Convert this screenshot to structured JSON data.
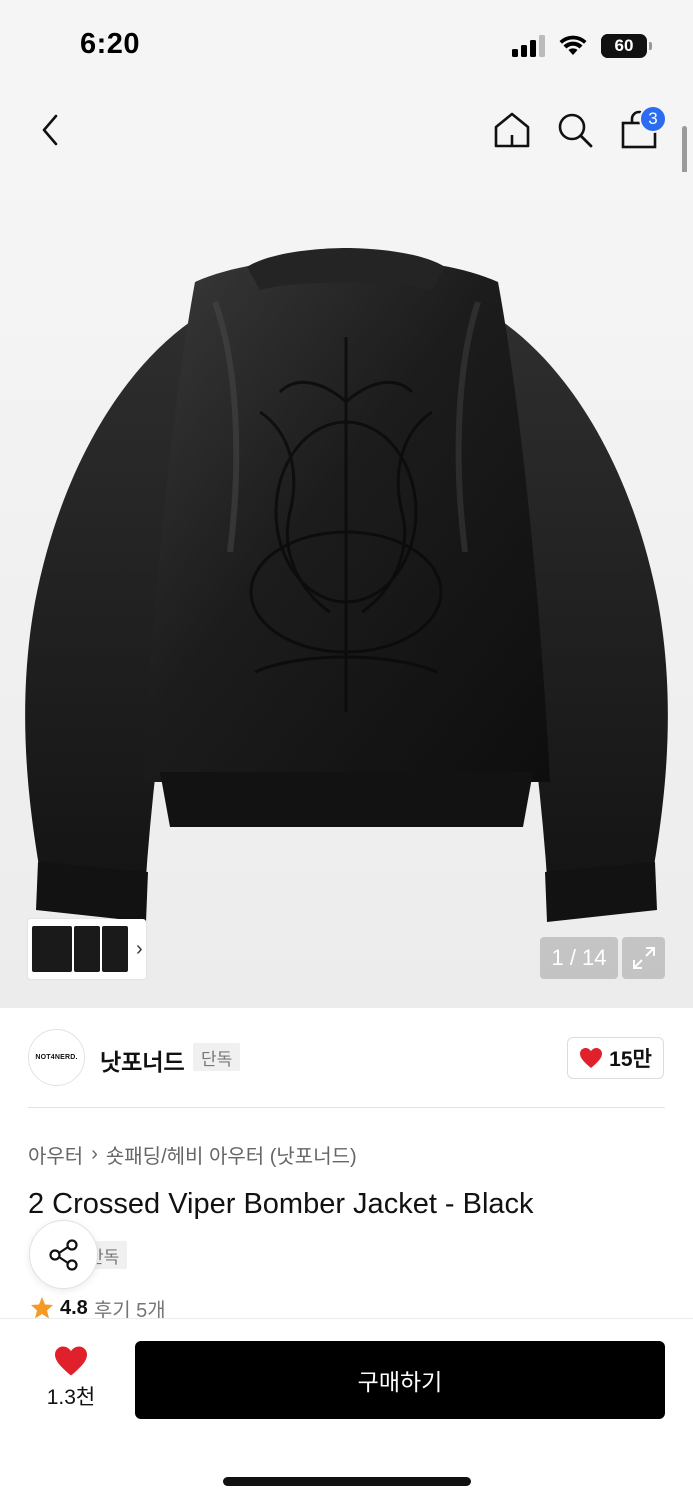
{
  "status_bar": {
    "time": "6:20",
    "battery": "60"
  },
  "header": {
    "cart_count": "3"
  },
  "gallery": {
    "pager": "1 / 14"
  },
  "brand": {
    "logo_text": "NOT4NERD.",
    "name": "낫포너드",
    "tag": "단독",
    "likes": "15만"
  },
  "breadcrumb": {
    "items": [
      "아우터",
      "숏패딩/헤비 아우터 (낫포너드)"
    ]
  },
  "product": {
    "title": "2 Crossed Viper Bomber Jacket - Black",
    "tag": "단독",
    "rating": "4.8",
    "reviews": "후기 5개"
  },
  "bottom_bar": {
    "wish_count": "1.3천",
    "buy_label": "구매하기"
  },
  "colors": {
    "accent_blue": "#2c6cf2",
    "heart_red": "#e0202a",
    "star_orange": "#f59a23"
  }
}
